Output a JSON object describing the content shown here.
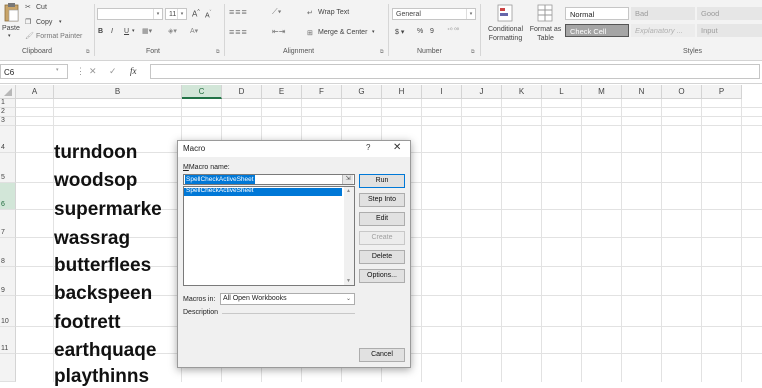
{
  "ribbon": {
    "clipboard": {
      "paste": "Paste",
      "cut": "Cut",
      "copy": "Copy",
      "format_painter": "Format Painter",
      "label": "Clipboard"
    },
    "font": {
      "size": "11",
      "label": "Font",
      "bold": "B",
      "italic": "I",
      "underline": "U"
    },
    "alignment": {
      "wrap_text": "Wrap Text",
      "merge_center": "Merge & Center",
      "label": "Alignment"
    },
    "number": {
      "format": "General",
      "currency": "$",
      "percent": "%",
      "comma": "9",
      "label": "Number"
    },
    "styles": {
      "conditional": "Conditional Formatting",
      "format_as_table": "Format as Table",
      "normal": "Normal",
      "bad": "Bad",
      "good": "Good",
      "check_cell": "Check Cell",
      "explanatory": "Explanatory ...",
      "input": "Input",
      "label": "Styles"
    }
  },
  "formula_bar": {
    "name_box": "C6",
    "fx": "fx",
    "cancel": "✕",
    "enter": "✓",
    "value": ""
  },
  "columns": [
    "A",
    "B",
    "C",
    "D",
    "E",
    "F",
    "G",
    "H",
    "I",
    "J",
    "K",
    "L",
    "M",
    "N",
    "O",
    "P"
  ],
  "selected_column": "C",
  "rows": [
    "1",
    "2",
    "3",
    "4",
    "5",
    "6",
    "7",
    "8",
    "9",
    "10",
    "11"
  ],
  "selected_row": "6",
  "cells_b": [
    "turndoon",
    "woodsop",
    "supermarke",
    "wassrag",
    "butterflees",
    "backspeen",
    "footrett",
    "earthquaqe",
    "playthinns"
  ],
  "dialog": {
    "title": "Macro",
    "help": "?",
    "close": "✕",
    "macro_name_label": "Macro name:",
    "macro_name_value": "SpellCheckActiveSheet",
    "list_items": [
      "SpellCheckActiveSheet"
    ],
    "buttons": {
      "run": "Run",
      "step_into": "Step Into",
      "edit": "Edit",
      "create": "Create",
      "delete": "Delete",
      "options": "Options...",
      "cancel": "Cancel"
    },
    "macros_in_label": "Macros in:",
    "macros_in_value": "All Open Workbooks",
    "description_label": "Description"
  },
  "colors": {
    "accent_green": "#217346",
    "selection_blue": "#0078d7"
  }
}
